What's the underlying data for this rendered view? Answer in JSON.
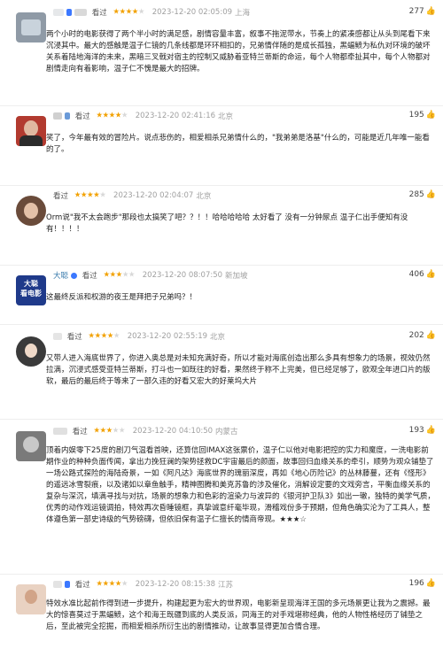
{
  "reviews": [
    {
      "seen": "看过",
      "rating": 4,
      "time": "2023-12-20 02:05:09",
      "location": "上海",
      "useful": "277",
      "text": "两个小时的电影获得了两个半小时的满足感，剧情容量丰富，叙事不拖泥带水，节奏上的紧凑感都让从头到尾看下来沉浸其中。最大的感触是温子仁镜的几条线都是环环相扣的，兄弟情伴随的是成长孤独，黑蝠鲼为私仇对环境的破坏关系着陆地海洋的未来，黑暗三叉戟对宿主的控制又威胁着亚特兰蒂斯的命运，每个人物都牵扯其中，每个人物都对剧情走向有着影响，温子仁不愧是最大的招牌。",
      "avatar_color": "#8f9aa6",
      "name_colors": [
        "#e6e8ea",
        "#3b78ff",
        "#d9d9d9"
      ]
    },
    {
      "seen": "看过",
      "rating": 4,
      "time": "2023-12-20 02:41:16",
      "location": "北京",
      "useful": "195",
      "text": "笑了，今年最有效的冒险片。说点悲伤的，相爱相杀兄弟情什么的，\"我弟弟是洛基\"什么的，可能是近几年唯一能看的了。",
      "avatar_color": "#b23a2f",
      "name_colors": [
        "#d0d0d0",
        "#6a9ad8",
        "#e0e0e0"
      ]
    },
    {
      "seen": "看过",
      "rating": 4,
      "time": "2023-12-20 02:04:07",
      "location": "北京",
      "useful": "285",
      "text": "Orm说\"我不太会跑步\"那段也太搞笑了吧？？！！哈哈哈哈哈 太好看了 没有一分钟尿点 温子仁出手便知有没有！！！！",
      "avatar_color": "#6a4b3a",
      "name_colors": [
        "#e0e0e0",
        "#cfcfcf"
      ]
    },
    {
      "name": "大聪",
      "seen": "看过",
      "rating": 3,
      "time": "2023-12-20 08:07:50",
      "location": "新加坡",
      "useful": "406",
      "text": "这最终反派和权游的夜王是拜把子兄弟吗？！",
      "avatar_color": "#1f3a8a",
      "avatar_text": "大聪\n看电影",
      "name_colors": []
    },
    {
      "seen": "看过",
      "rating": 4,
      "time": "2023-12-20 02:55:19",
      "location": "北京",
      "useful": "202",
      "text": "又带人进入海底世界了，你进入奥总是对未知充满好奇，所以才能对海底创造出那么多具有想象力的场景，视效仍然拉满，沉浸式感受亚特兰蒂斯，打斗也一如既往的好看，果然终于称不上完美，但已经足够了，欧观全年进口片的版软，最后的最后终于等来了一部久违的好看又宏大的好莱坞大片",
      "avatar_color": "#3a3a3a",
      "name_colors": [
        "#e5e5e5",
        "#e5e5e5"
      ]
    },
    {
      "seen": "看过",
      "rating": 3,
      "time": "2023-12-20 04:10:50",
      "location": "内蒙古",
      "useful": "193",
      "text": "顶着内娱零下25度的剧刀气温看首映，还算信回IMAX这张票价，温子仁以他对电影把控的实力和魔度，一洗电影前期作业的种种负面传闻，拿出力挽狂澜的架势拯救DC宇宙最后的颜面，故事回归血缘关系的牵引，顺势为观众铺垫了一场公路式探险的海陆奇景，一如《阿凡达》海底世界的瑰丽深度，再如《地心历险记》的丛林藤蔓，还有《怪形》的遥远冰雪裂痕，以及诸如以章鱼触手，精神图腾和美克苏鲁的涉及催化，消解设定要的文戏旁言，平衡血缘关系的复杂与深沉，填满寻找与对抗，场景的想象力和色彩的渲染力与波异的《银河护卫队3》如出一辙，独特的美学气质，优秀的动作戏运镜调拍，特效再次昏睡镜框，真挚诚意纤毫毕现，滑稽戏份多于预期，但角色确实沦为了工具人，整体遵色第一部史诗级的气势磅礴，但依旧保有温子仁擅长的情商帝现。★★★☆",
      "avatar_color": "#7a7a7a",
      "name_colors": [
        "#e0e0e0",
        "#e0e0e0"
      ]
    },
    {
      "seen": "看过",
      "rating": 4,
      "time": "2023-12-20 08:15:38",
      "location": "江苏",
      "useful": "196",
      "text": "特效水准比起前作得到进一步提升，构建起更为宏大的世界观，电影新呈现海洋王国的多元场景更让我为之震撼。最大的惊喜莫过于黑蝠鲼，这个和海王既疆到底的人类反派，同海王的对手戏堪称经典，他的人物性格经历了铺垫之后，至此被完全挖掘，而相爱相杀所衍生出的剧情推动，让故事显得更加合情合理。",
      "avatar_color": "#e9d2c2",
      "name_colors": [
        "#e3e3e3",
        "#3b78ff",
        "#d8d8d8"
      ]
    }
  ]
}
